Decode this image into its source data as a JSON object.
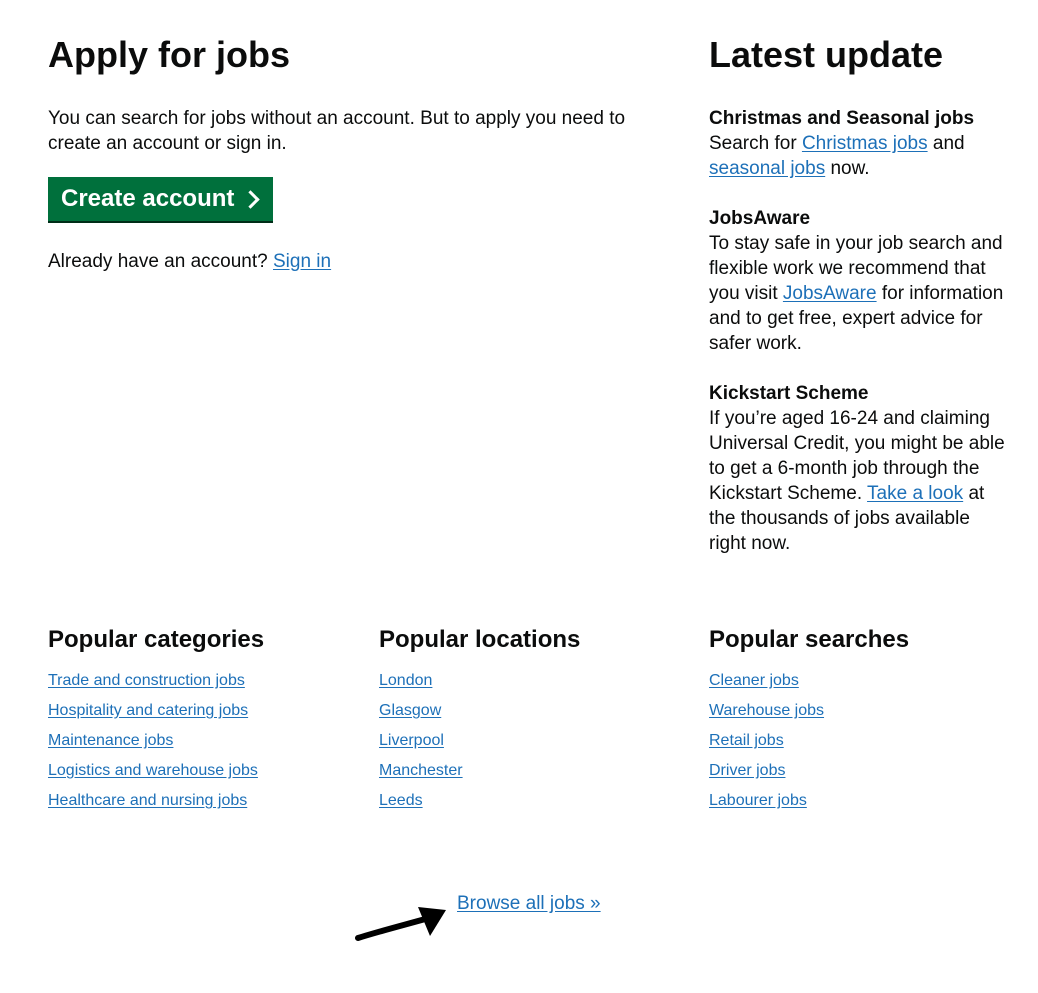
{
  "apply": {
    "title": "Apply for jobs",
    "intro": "You can search for jobs without an account. But to apply you need to create an account or sign in.",
    "create_account_label": "Create account",
    "signin_prefix": "Already have an account?",
    "signin_link": "Sign in"
  },
  "latest": {
    "title": "Latest update",
    "updates": [
      {
        "heading": "Christmas and Seasonal jobs",
        "text_1": "Search for",
        "link_1": "Christmas jobs",
        "text_2": "and",
        "link_2": "seasonal jobs",
        "text_3": "now."
      },
      {
        "heading": "JobsAware",
        "text_1": "To stay safe in your job search and flexible work we recommend that you visit",
        "link_1": "JobsAware",
        "text_2": "for information and to get free, expert advice for safer work."
      },
      {
        "heading": "Kickstart Scheme",
        "text_1": "If you’re aged 16-24 and claiming Universal Credit, you might be able to get a 6-month job through the Kickstart Scheme.",
        "link_1": "Take a look",
        "text_2": "at the thousands of jobs available right now."
      }
    ]
  },
  "popular": {
    "categories": {
      "title": "Popular categories",
      "items": [
        "Trade and construction jobs",
        "Hospitality and catering jobs",
        "Maintenance jobs",
        "Logistics and warehouse jobs",
        "Healthcare and nursing jobs"
      ]
    },
    "locations": {
      "title": "Popular locations",
      "items": [
        "London",
        "Glasgow",
        "Liverpool",
        "Manchester",
        "Leeds"
      ]
    },
    "searches": {
      "title": "Popular searches",
      "items": [
        "Cleaner jobs",
        "Warehouse jobs",
        "Retail jobs",
        "Driver jobs",
        "Labourer jobs"
      ]
    }
  },
  "browse_all": "Browse all jobs »",
  "colors": {
    "link": "#1d70b8",
    "button": "#00703c",
    "text": "#0b0c0c"
  }
}
